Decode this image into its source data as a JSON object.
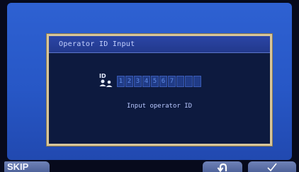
{
  "dialog": {
    "title": "Operator ID Input",
    "id_icon_label": "ID",
    "digits": [
      "1",
      "2",
      "3",
      "4",
      "5",
      "6",
      "7",
      "",
      "",
      ""
    ],
    "message": "Input operator ID"
  },
  "footer": {
    "skip_label": "SKIP",
    "return_icon": "return-arrow-icon",
    "ok_icon": "checkmark-icon"
  },
  "colors": {
    "display_blue": "#2757c6",
    "dialog_border": "#d8c69a",
    "dialog_bg": "#0d1a3f",
    "digit_text": "#5f8be6",
    "button_bg": "#5b6fa6"
  }
}
